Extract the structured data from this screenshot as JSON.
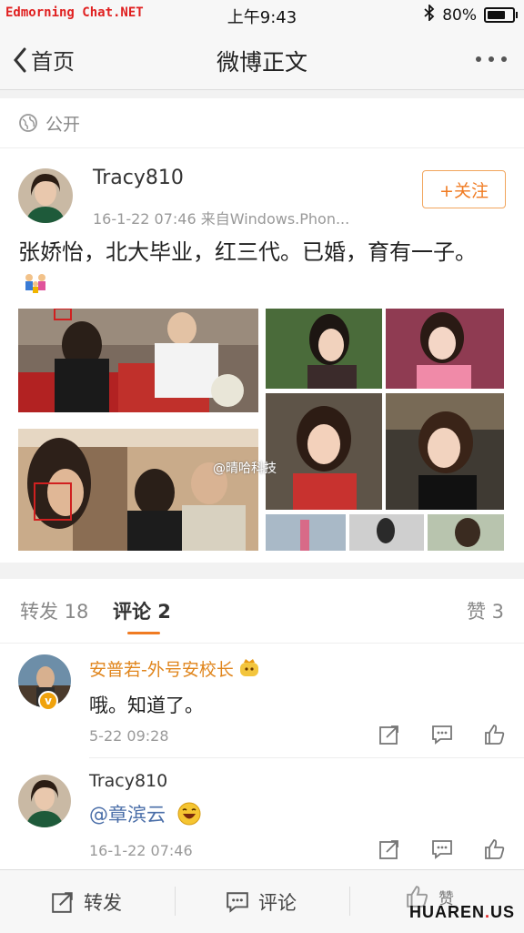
{
  "status_bar": {
    "left_overlay": "Edmorning Chat.NET",
    "time": "上午9:43",
    "battery": "80%",
    "battery_level": 0.8
  },
  "nav": {
    "back_label": "首页",
    "title": "微博正文",
    "more": "···"
  },
  "visibility": {
    "label": "公开",
    "icon": "globe-icon"
  },
  "post": {
    "username": "Tracy810",
    "meta": "16-1-22 07:46  来自Windows.Phon...",
    "follow_label": "+关注",
    "text": "张娇怡，北大毕业，红三代。已婚，育有一子。",
    "watermark": "@晴哈科技"
  },
  "tabs": {
    "repost": "转发 18",
    "comments": "评论 2",
    "likes": "赞 3"
  },
  "comments": [
    {
      "name": "安普若-外号安校长",
      "text": "哦。知道了。",
      "time": "5-22 09:28",
      "name_color": "#e0851c"
    },
    {
      "name": "Tracy810",
      "text": "@章滨云",
      "time": "16-1-22 07:46",
      "name_color": "#333333"
    }
  ],
  "bottom_bar": {
    "repost": "转发",
    "comment": "评论",
    "like": "赞"
  },
  "brand_watermark": {
    "text": "HUAREN",
    "dot": ".",
    "suffix": "US"
  }
}
